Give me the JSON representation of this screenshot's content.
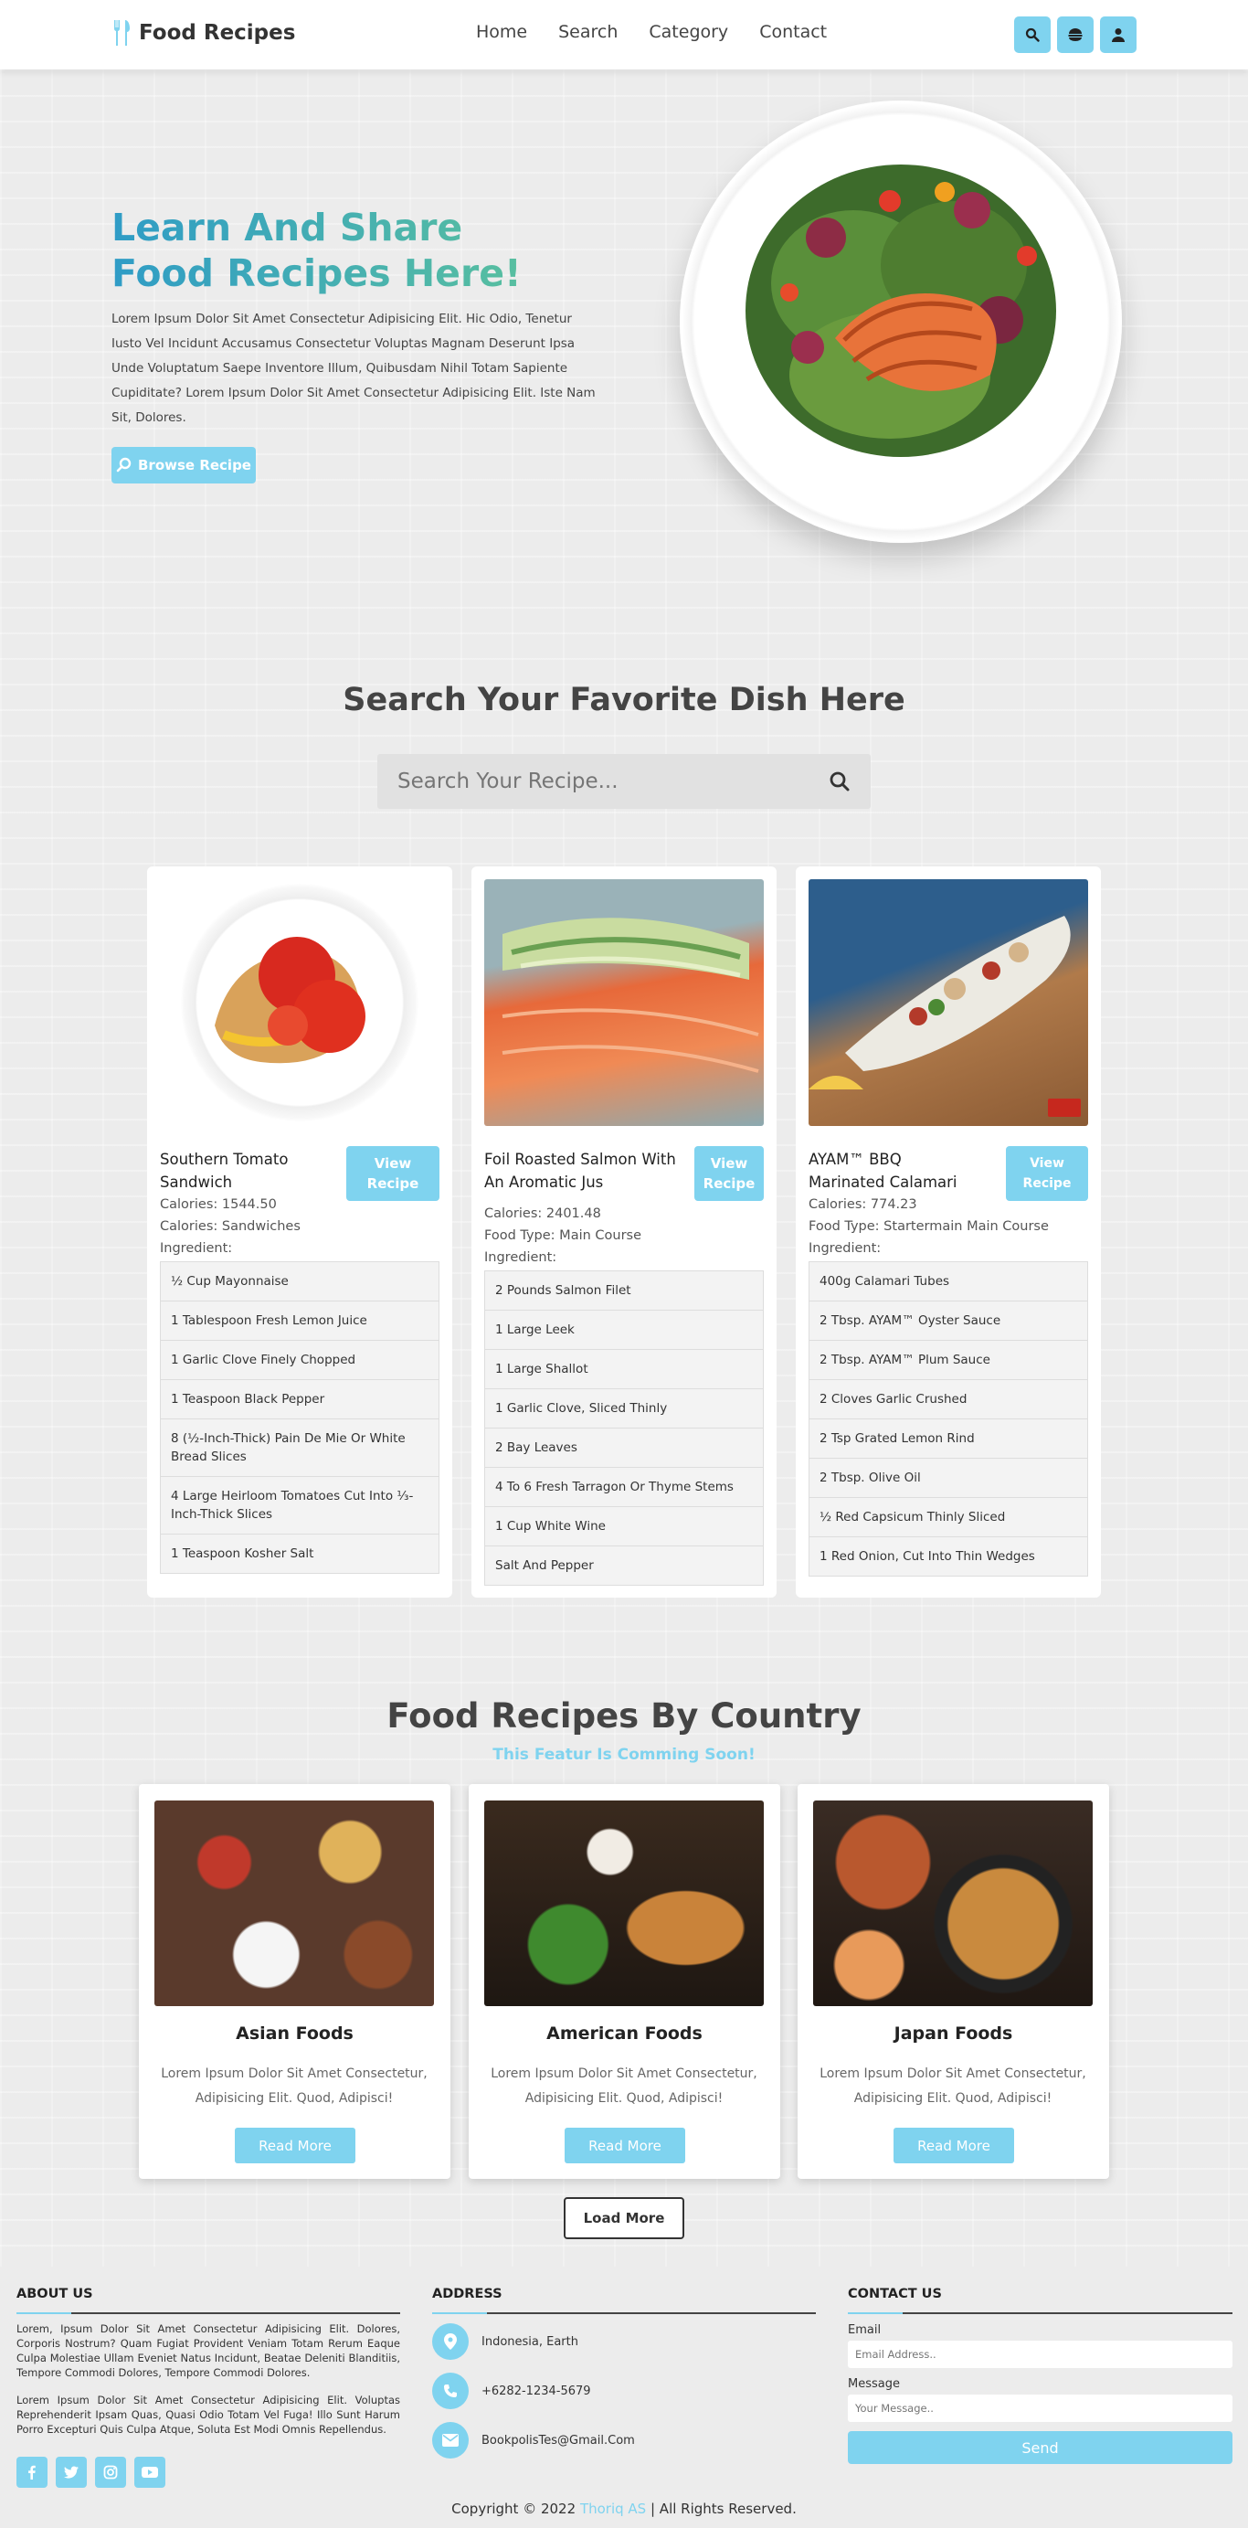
{
  "header": {
    "logo_text": "Food Recipes",
    "nav": [
      "Home",
      "Search",
      "Category",
      "Contact"
    ],
    "icons": [
      "search-icon",
      "burger-icon",
      "user-icon"
    ]
  },
  "hero": {
    "title_line1": "Learn And Share",
    "title_line2": "Food Recipes Here!",
    "description": "Lorem Ipsum Dolor Sit Amet Consectetur Adipisicing Elit. Hic Odio, Tenetur Iusto Vel Incidunt Accusamus Consectetur Voluptas Magnam Deserunt Ipsa Unde Voluptatum Saepe Inventore Illum, Quibusdam Nihil Totam Sapiente Cupiditate? Lorem Ipsum Dolor Sit Amet Consectetur Adipisicing Elit. Iste Nam Sit, Dolores.",
    "browse_label": "Browse Recipe"
  },
  "search": {
    "title": "Search Your Favorite Dish Here",
    "placeholder": "Search Your Recipe..."
  },
  "recipes": [
    {
      "name": "Southern Tomato Sandwich",
      "view_label": "View Recipe",
      "calories": "Calories: 1544.50",
      "food_type": "Calories: Sandwiches",
      "ingredient_label": "Ingredient:",
      "ingredients": [
        "½ Cup Mayonnaise",
        "1 Tablespoon Fresh Lemon Juice",
        "1 Garlic Clove Finely Chopped",
        "1 Teaspoon Black Pepper",
        "8 (½-Inch-Thick) Pain De Mie Or White Bread Slices",
        "4 Large Heirloom Tomatoes Cut Into ⅓-Inch-Thick Slices",
        "1 Teaspoon Kosher Salt"
      ]
    },
    {
      "name": "Foil Roasted Salmon With An Aromatic Jus",
      "view_label": "View Recipe",
      "calories": "Calories: 2401.48",
      "food_type": "Food Type: Main Course",
      "ingredient_label": "Ingredient:",
      "ingredients": [
        "2 Pounds Salmon Filet",
        "1 Large Leek",
        "1 Large Shallot",
        "1 Garlic Clove, Sliced Thinly",
        "2 Bay Leaves",
        "4 To 6 Fresh Tarragon Or Thyme Stems",
        "1 Cup White Wine",
        "Salt And Pepper"
      ]
    },
    {
      "name": "AYAM™ BBQ Marinated Calamari",
      "view_label": "View Recipe",
      "calories": "Calories: 774.23",
      "food_type": "Food Type: Startermain Main Course",
      "ingredient_label": "Ingredient:",
      "ingredients": [
        "400g Calamari Tubes",
        "2 Tbsp. AYAM™ Oyster Sauce",
        "2 Tbsp. AYAM™ Plum Sauce",
        "2 Cloves Garlic Crushed",
        "2 Tsp Grated Lemon Rind",
        "2 Tbsp. Olive Oil",
        "½ Red Capsicum Thinly Sliced",
        "1 Red Onion, Cut Into Thin Wedges"
      ]
    }
  ],
  "countries": {
    "title": "Food Recipes By Country",
    "subtitle": "This Featur Is Comming Soon!",
    "items": [
      {
        "name": "Asian Foods",
        "desc": "Lorem Ipsum Dolor Sit Amet Consectetur, Adipisicing Elit. Quod, Adipisci!",
        "button": "Read More"
      },
      {
        "name": "American Foods",
        "desc": "Lorem Ipsum Dolor Sit Amet Consectetur, Adipisicing Elit. Quod, Adipisci!",
        "button": "Read More"
      },
      {
        "name": "Japan Foods",
        "desc": "Lorem Ipsum Dolor Sit Amet Consectetur, Adipisicing Elit. Quod, Adipisci!",
        "button": "Read More"
      }
    ],
    "load_more": "Load More"
  },
  "footer": {
    "about_title": "ABOUT US",
    "about_p1": "Lorem, Ipsum Dolor Sit Amet Consectetur Adipisicing Elit. Dolores, Corporis Nostrum? Quam Fugiat Provident Veniam Totam Rerum Eaque Culpa Molestiae Ullam Eveniet Natus Incidunt, Beatae Deleniti Blanditiis, Tempore Commodi Dolores, Tempore Commodi Dolores.",
    "about_p2": "Lorem Ipsum Dolor Sit Amet Consectetur Adipisicing Elit. Voluptas Reprehenderit Ipsam Quas, Quasi Odio Totam Vel Fuga! Illo Sunt Harum Porro Excepturi Quis Culpa Atque, Soluta Est Modi Omnis Repellendus.",
    "socials": [
      "facebook-icon",
      "twitter-icon",
      "instagram-icon",
      "youtube-icon"
    ],
    "address_title": "ADDRESS",
    "location": "Indonesia, Earth",
    "phone": "+6282-1234-5679",
    "email": "BookpolisTes@Gmail.Com",
    "contact_title": "CONTACT US",
    "email_label": "Email",
    "email_placeholder": "Email Address..",
    "message_label": "Message",
    "message_placeholder": "Your Message..",
    "send_label": "Send",
    "copyright_prefix": "Copyright © 2022",
    "copyright_name": "Thoriq AS",
    "copyright_suffix": "| All Rights Reserved."
  },
  "colors": {
    "accent": "#7fd3ef",
    "title_gradient_start": "#2f9cc6",
    "title_gradient_end": "#58bfa0"
  }
}
